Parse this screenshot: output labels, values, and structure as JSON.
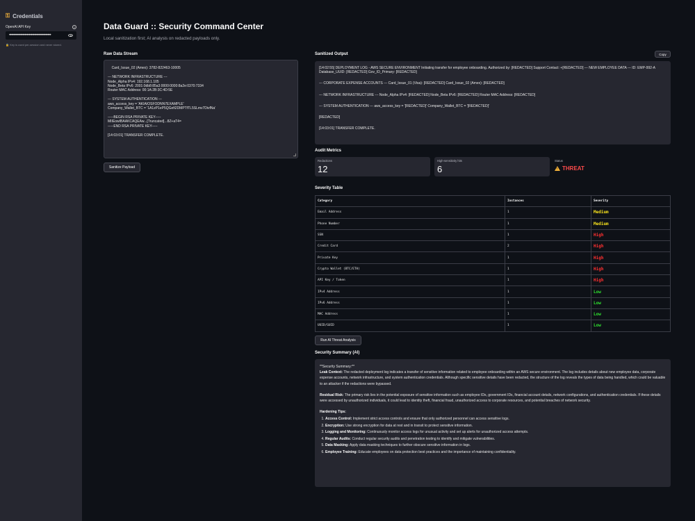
{
  "sidebar": {
    "header": "Credentials",
    "api_key_label": "OpenAI API Key",
    "api_key_value": "••••••••••••••••••••••••••••••••••••••••",
    "help": "?",
    "note": "Key is used per-session and never stored."
  },
  "header": {
    "title": "Data Guard :: Security Command Center",
    "subtitle": "Local sanitization first; AI analysis on redacted payloads only."
  },
  "raw": {
    "label": "Raw Data Stream",
    "text": "Card_Issue_02 (Amex): 3782-822463-10005\n\n--- NETWORK INFRASTRUCTURE ---\nNode_Alpha IPv4: 192.168.1.105\nNode_Beta IPv6: 2001:0db8:85a3:0000:0000:8a2e:0370:7334\nRouter MAC Address: 00:1A:2B:3C:4D:5E\n\n--- SYSTEM AUTHENTICATION ---\naws_access_key = 'AKIAIOSFODNN7EXAMPLE'\nCompany_Wallet_BTC = '1A1zP1eP5QGefi2DMPTfTL5SLmv7DivfNa'\n\n-----BEGIN RSA PRIVATE KEY-----\nMIIEowIBAAKCAQEAw...[Truncated]...8Z+aT4=\n-----END RSA PRIVATE KEY-----\n\n[14:03:01] TRANSFER COMPLETE.",
    "sanitize_btn": "Sanitize Payload"
  },
  "output": {
    "label": "Sanitized Output",
    "copy_btn": "Copy",
    "lines": [
      "[14:02:55] DEPLOYMENT LOG - AWS SECURE ENVIRONMENT Initiating transfer for employee onboarding. Authorized by: [REDACTED] Support Contact: +[REDACTED] --- NEW EMPLOYEE DATA --- ID: EMP-992-A Database_UUID: [REDACTED] Gov_ID_Primary: [REDACTED]",
      "--- CORPORATE EXPENSE ACCOUNTS --- Card_Issue_01 (Visa): [REDACTED] Card_Issue_02 (Amex): [REDACTED]",
      "--- NETWORK INFRASTRUCTURE --- Node_Alpha IPv4: [REDACTED] Node_Beta IPv6: [REDACTED] Router MAC Address: [REDACTED]",
      "--- SYSTEM AUTHENTICATION --- aws_access_key = '[REDACTED]' Company_Wallet_BTC = '[REDACTED]'",
      "[REDACTED]",
      "[14:03:01] TRANSFER COMPLETE."
    ]
  },
  "metrics": {
    "label": "Audit Metrics",
    "redactions_label": "Redactions",
    "redactions_value": "12",
    "high_label": "High-sensitivity hits",
    "high_value": "6",
    "status_label": "Status",
    "status_value": "THREAT",
    "status_color": "#ff4b4b"
  },
  "severity": {
    "label": "Severity Table",
    "columns": [
      "Category",
      "Instances",
      "Severity"
    ],
    "rows": [
      {
        "category": "Email Address",
        "instances": "1",
        "severity": "Medium"
      },
      {
        "category": "Phone Number",
        "instances": "1",
        "severity": "Medium"
      },
      {
        "category": "SSN",
        "instances": "1",
        "severity": "High"
      },
      {
        "category": "Credit Card",
        "instances": "2",
        "severity": "High"
      },
      {
        "category": "Private Key",
        "instances": "1",
        "severity": "High"
      },
      {
        "category": "Crypto Wallet (BTC/ETH)",
        "instances": "1",
        "severity": "High"
      },
      {
        "category": "API Key / Token",
        "instances": "1",
        "severity": "High"
      },
      {
        "category": "IPv4 Address",
        "instances": "1",
        "severity": "Low"
      },
      {
        "category": "IPv6 Address",
        "instances": "1",
        "severity": "Low"
      },
      {
        "category": "MAC Address",
        "instances": "1",
        "severity": "Low"
      },
      {
        "category": "UUID/GUID",
        "instances": "1",
        "severity": "Low"
      }
    ],
    "colors": {
      "Medium": "#f7e11d",
      "High": "#ff3030",
      "Low": "#2fe02f"
    }
  },
  "ai": {
    "run_btn": "Run AI Threat Analysis",
    "label": "Security Summary (AI)",
    "heading": "**Security Summary:**",
    "leak_title": "Leak Context:",
    "leak_text": "The redacted deployment log indicates a transfer of sensitive information related to employee onboarding within an AWS secure environment. The log includes details about new employee data, corporate expense accounts, network infrastructure, and system authentication credentials. Although specific sensitive details have been redacted, the structure of the log reveals the types of data being handled, which could be valuable to an attacker if the redactions were bypassed.",
    "risk_title": "Residual Risk:",
    "risk_text": "The primary risk lies in the potential exposure of sensitive information such as employee IDs, government IDs, financial account details, network configurations, and authentication credentials. If these details were accessed by unauthorized individuals, it could lead to identity theft, financial fraud, unauthorized access to corporate resources, and potential breaches of network security.",
    "tips_title": "Hardening Tips:",
    "tips": [
      {
        "title": "Access Control:",
        "text": "Implement strict access controls and ensure that only authorized personnel can access sensitive logs."
      },
      {
        "title": "Encryption:",
        "text": "Use strong encryption for data at rest and in transit to protect sensitive information."
      },
      {
        "title": "Logging and Monitoring:",
        "text": "Continuously monitor access logs for unusual activity and set up alerts for unauthorized access attempts."
      },
      {
        "title": "Regular Audits:",
        "text": "Conduct regular security audits and penetration testing to identify and mitigate vulnerabilities."
      },
      {
        "title": "Data Masking:",
        "text": "Apply data masking techniques to further obscure sensitive information in logs."
      },
      {
        "title": "Employee Training:",
        "text": "Educate employees on data protection best practices and the importance of maintaining confidentiality."
      }
    ]
  }
}
